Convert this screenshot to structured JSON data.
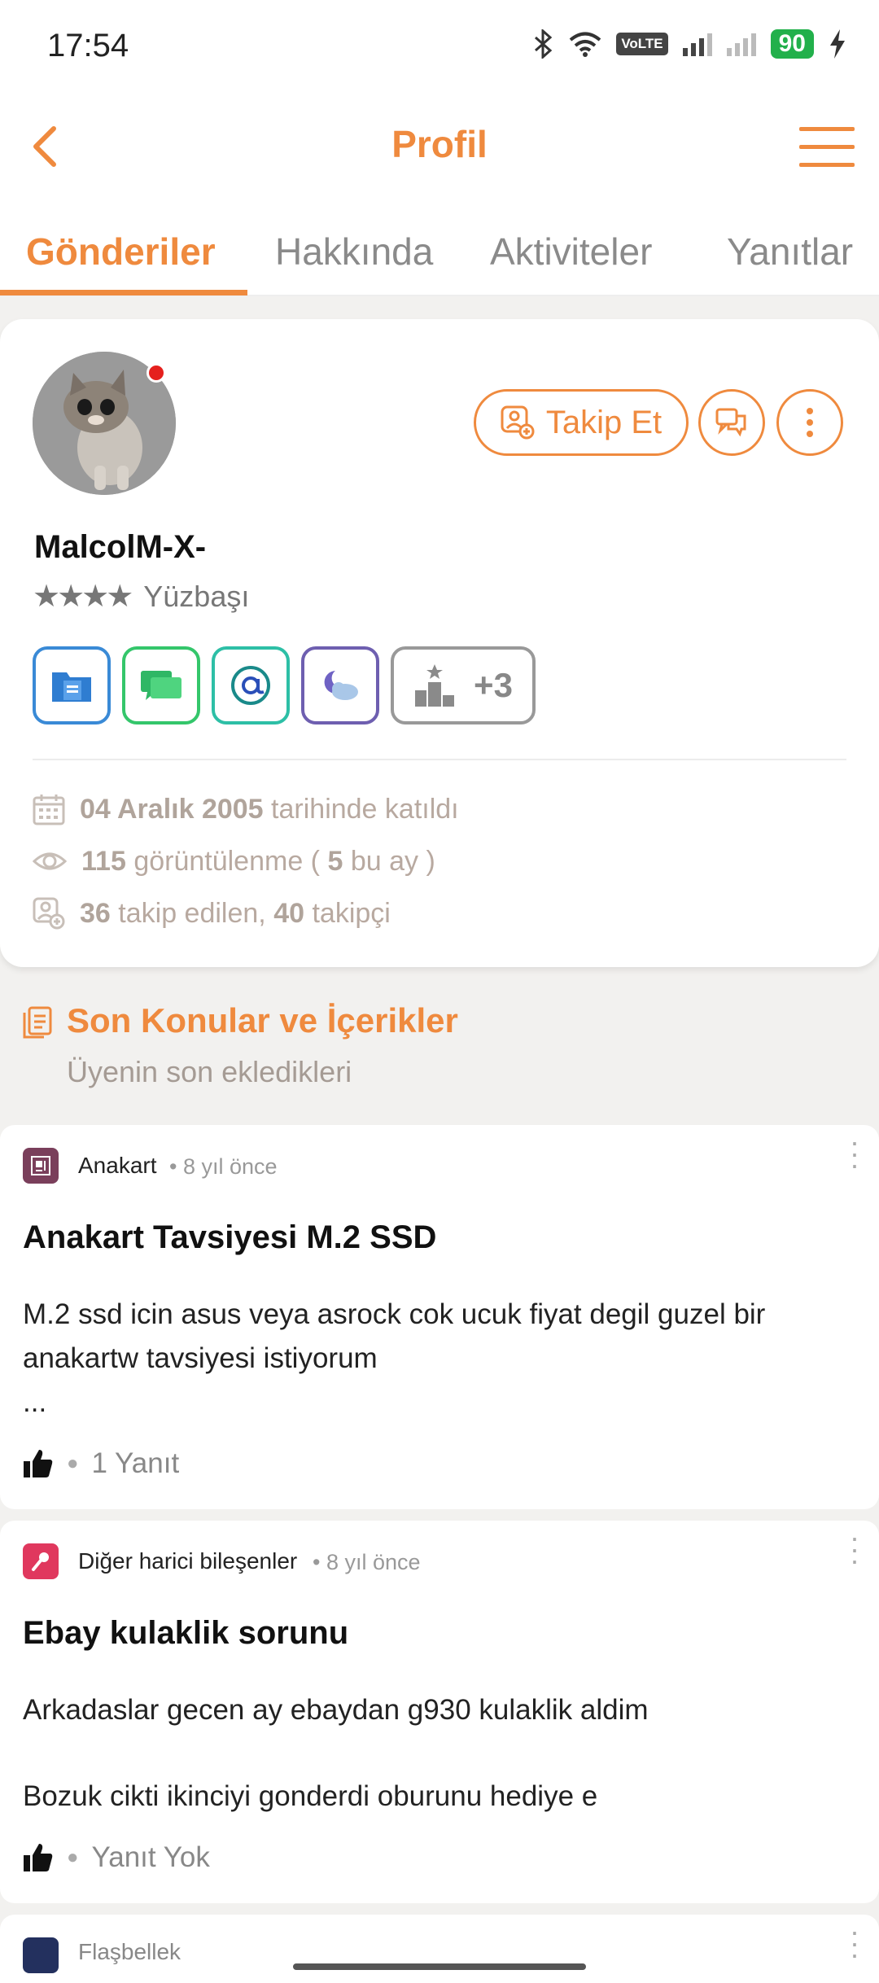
{
  "status_bar": {
    "time": "17:54",
    "volte": "VoLTE",
    "battery": "90"
  },
  "header": {
    "title": "Profil"
  },
  "tabs": [
    {
      "label": "Gönderiler",
      "active": true
    },
    {
      "label": "Hakkında",
      "active": false
    },
    {
      "label": "Aktiviteler",
      "active": false
    },
    {
      "label": "Yanıtlar",
      "active": false
    }
  ],
  "profile": {
    "username": "MalcolM-X-",
    "stars": "★★★★",
    "rank": "Yüzbaşı",
    "follow_label": "Takip Et",
    "badges_more": "+3",
    "joined_date": "04 Aralık 2005",
    "joined_suffix": "tarihinde katıldı",
    "views_count": "115",
    "views_mid": "görüntülenme (",
    "views_month": "5",
    "views_suffix": "bu ay )",
    "following_count": "36",
    "following_label": "takip edilen,",
    "followers_count": "40",
    "followers_label": "takipçi"
  },
  "section": {
    "title": "Son Konular ve İçerikler",
    "subtitle": "Üyenin son ekledikleri"
  },
  "posts": [
    {
      "category": "Anakart",
      "time": "• 8 yıl önce",
      "title": "Anakart Tavsiyesi M.2 SSD",
      "body_1": " M.2 ssd icin asus veya asrock cok ucuk fiyat degil guzel bir",
      "body_2": "anakartw tavsiyesi istiyorum",
      "body_3": " ...",
      "replies": "1 Yanıt"
    },
    {
      "category": "Diğer harici bileşenler",
      "time": "• 8 yıl önce",
      "title": "Ebay kulaklik sorunu",
      "body_1": " Arkadaslar gecen ay ebaydan g930 kulaklik aldim",
      "body_2": "Bozuk cikti ikinciyi gonderdi oburunu hediye e",
      "replies": "Yanıt Yok"
    }
  ],
  "third_post": {
    "category": "Flaşbellek"
  },
  "colors": {
    "accent": "#ef8a3e",
    "online": "#e5201d",
    "battery": "#22b04b"
  }
}
